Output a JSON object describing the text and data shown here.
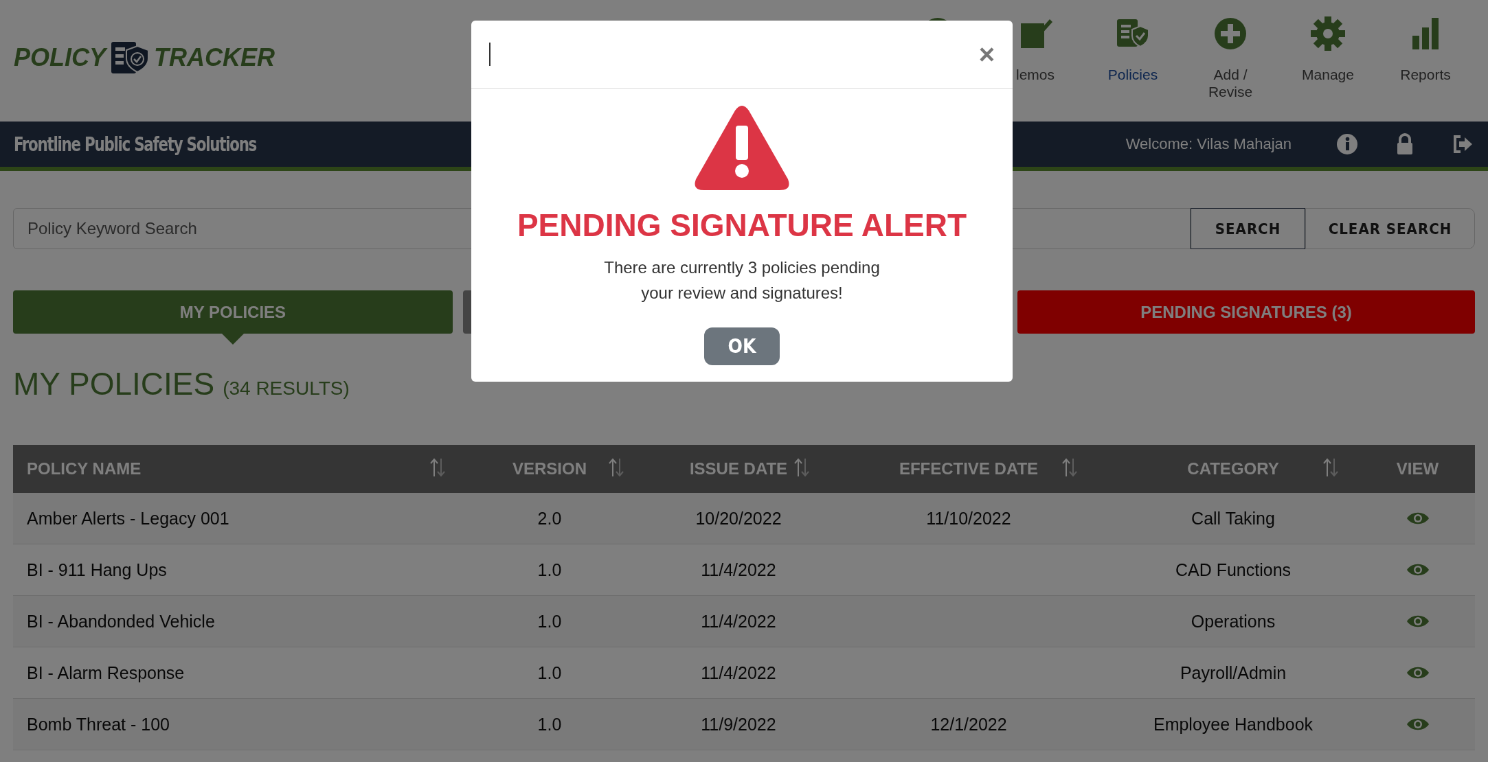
{
  "header": {
    "logo": {
      "left": "POLICY",
      "right": "TRACKER"
    },
    "nav": [
      {
        "kind": "circle"
      },
      {
        "kind": "memo",
        "label": "lemos",
        "selected": false
      },
      {
        "kind": "policy",
        "label": "Policies",
        "selected": true
      },
      {
        "kind": "add",
        "label": "Add / Revise",
        "selected": false
      },
      {
        "kind": "gear",
        "label": "Manage",
        "selected": false
      },
      {
        "kind": "chart",
        "label": "Reports",
        "selected": false
      }
    ]
  },
  "bar": {
    "organization": "Frontline Public Safety Solutions",
    "welcome": "Welcome: Vilas Mahajan"
  },
  "search": {
    "placeholder": "Policy Keyword Search",
    "buttons": [
      "SEARCH",
      "CLEAR SEARCH"
    ]
  },
  "tabs": [
    {
      "kind": "primary",
      "label": "MY POLICIES",
      "selected": true
    },
    {
      "kind": "secondary"
    },
    {
      "kind": "alert",
      "label": "PENDING SIGNATURES (3)",
      "selected": false
    }
  ],
  "heading": {
    "title": "MY POLICIES",
    "count": "(34 RESULTS)"
  },
  "table": {
    "columns": [
      {
        "label": "POLICY NAME",
        "sortable": true
      },
      {
        "label": "VERSION",
        "sortable": true
      },
      {
        "label": "ISSUE DATE",
        "sortable": true
      },
      {
        "label": "EFFECTIVE DATE",
        "sortable": true
      },
      {
        "label": "CATEGORY",
        "sortable": true
      },
      {
        "label": "VIEW",
        "sortable": false
      }
    ],
    "rows": [
      {
        "cells": [
          "Amber Alerts - Legacy 001",
          "2.0",
          "10/20/2022",
          "11/10/2022",
          "Call Taking"
        ]
      },
      {
        "cells": [
          "BI - 911 Hang Ups",
          "1.0",
          "11/4/2022",
          "",
          "CAD Functions"
        ]
      },
      {
        "cells": [
          "BI - Abandonded Vehicle",
          "1.0",
          "11/4/2022",
          "",
          "Operations"
        ]
      },
      {
        "cells": [
          "BI - Alarm Response",
          "1.0",
          "11/4/2022",
          "",
          "Payroll/Admin"
        ]
      },
      {
        "cells": [
          "Bomb Threat - 100",
          "1.0",
          "11/9/2022",
          "12/1/2022",
          "Employee Handbook"
        ]
      }
    ]
  },
  "modal": {
    "heading": "PENDING SIGNATURE ALERT",
    "message": "There are currently 3 policies pending your review and signatures!",
    "close": "×",
    "button": "OK"
  }
}
